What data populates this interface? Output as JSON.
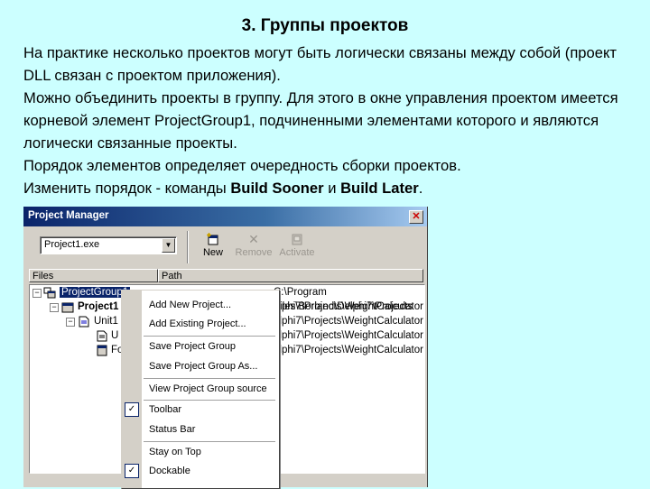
{
  "slide": {
    "title": "3. Группы проектов",
    "paragraph1": "На практике несколько проектов могут быть логически связаны между собой (проект DLL связан с проектом приложения).",
    "paragraph2": "Можно объединить проекты в группу. Для этого в окне управления проектом имеется корневой элемент ProjectGroup1, подчиненными элементами которого и являются логически связанные проекты.",
    "paragraph3": "Порядок элементов определяет очередность сборки проектов.",
    "paragraph4_prefix": "Изменить порядок  - команды ",
    "cmd_sooner": "Build Sooner",
    "paragraph4_and": " и ",
    "cmd_later": "Build Later",
    "paragraph4_suffix": "."
  },
  "window": {
    "title": "Project Manager",
    "project_select": "Project1.exe",
    "toolbar": {
      "new": "New",
      "remove": "Remove",
      "activate": "Activate"
    },
    "columns": {
      "files": "Files",
      "path": "Path"
    },
    "tree": [
      {
        "label": "ProjectGroup1",
        "path": "C:\\Program Files\\Borland\\Delphi7\\Projects"
      },
      {
        "label": "Project1",
        "path": "elphi7\\Projects\\WeightCalculator"
      },
      {
        "label": "Unit1",
        "path": "elphi7\\Projects\\WeightCalculator"
      },
      {
        "label": "U",
        "path": "elphi7\\Projects\\WeightCalculator"
      },
      {
        "label": "Fo",
        "path": "elphi7\\Projects\\WeightCalculator"
      }
    ]
  },
  "context_menu": {
    "add_new_project": "Add New Project...",
    "add_existing_project": "Add Existing Project...",
    "save_project_group": "Save Project Group",
    "save_project_group_as": "Save Project Group As...",
    "view_project_group_source": "View Project Group source",
    "toolbar": "Toolbar",
    "status_bar": "Status Bar",
    "stay_on_top": "Stay on Top",
    "dockable": "Dockable",
    "check_mark": "✓"
  }
}
